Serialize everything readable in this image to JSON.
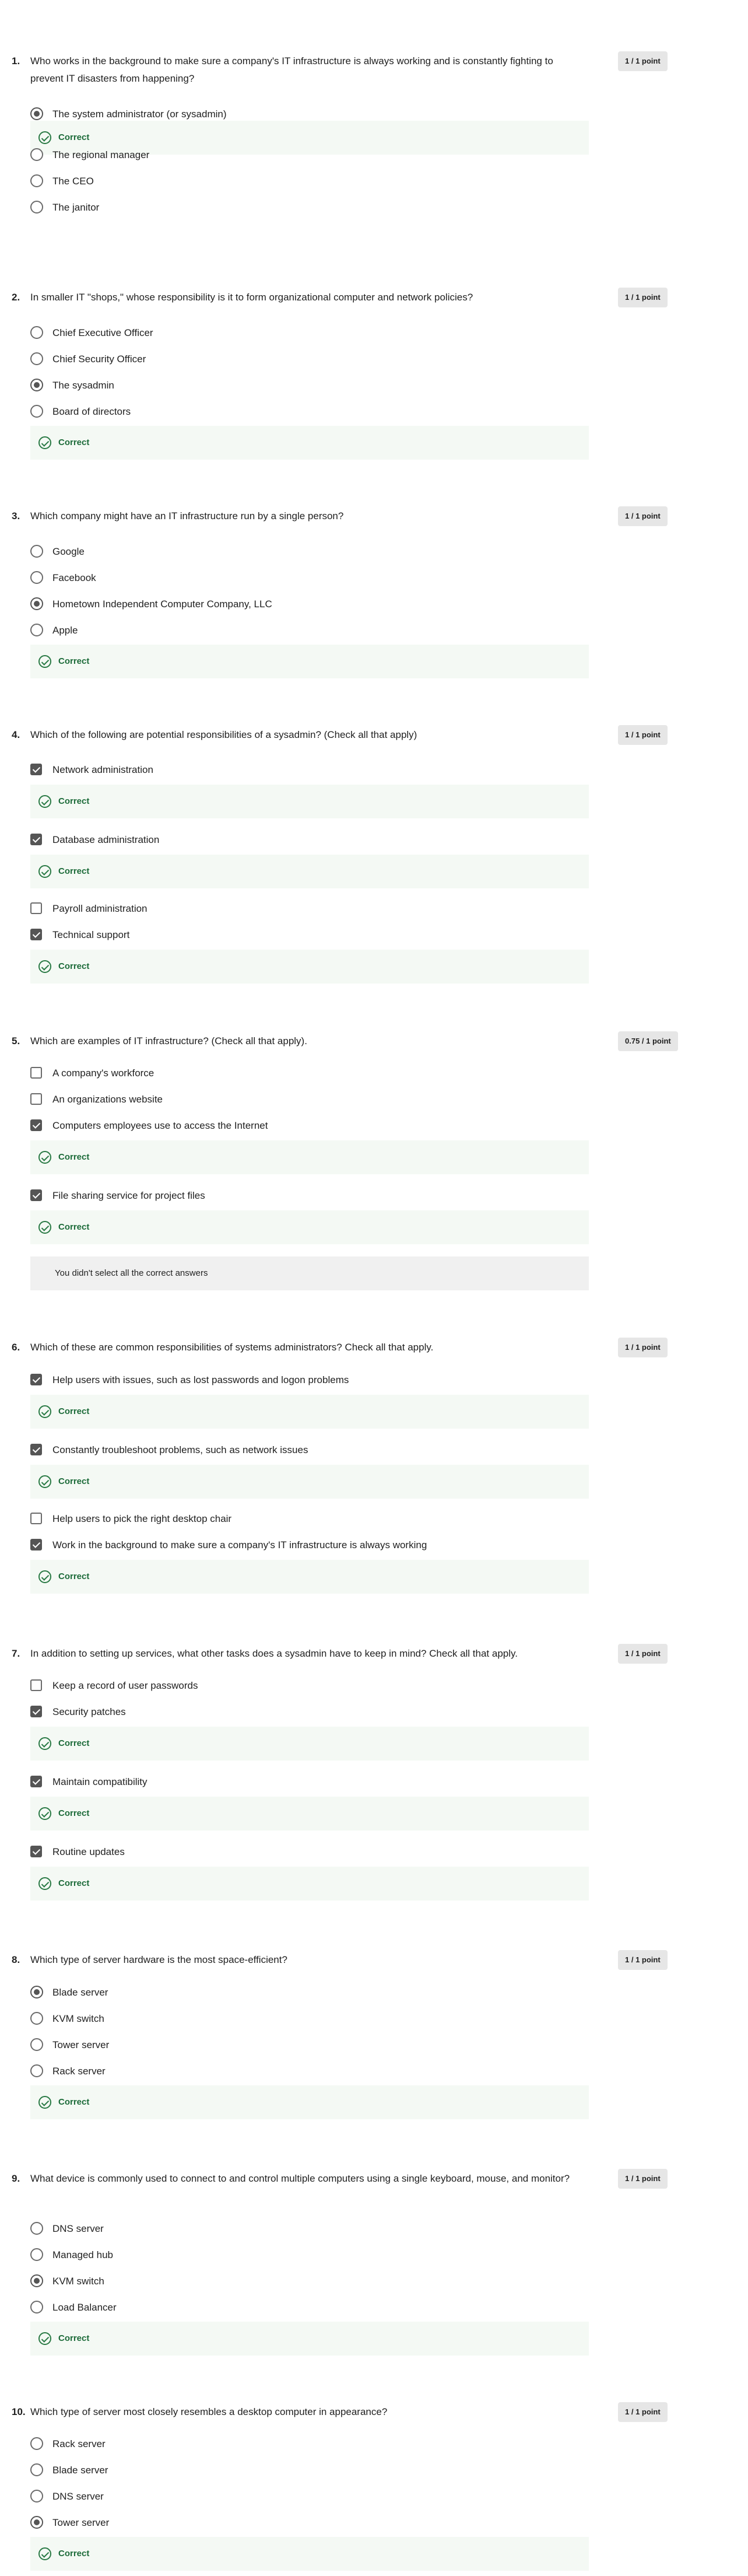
{
  "questions": [
    {
      "number": "1.",
      "text": "Who works in the background to make sure a company's IT infrastructure is always working and is constantly fighting to prevent IT disasters from happening?",
      "points": "1 / 1 point",
      "items": [
        {
          "kind": "radio",
          "label": "The system administrator (or sysadmin)",
          "selected": true
        },
        {
          "kind": "feedback",
          "label": "Correct"
        },
        {
          "kind": "radio",
          "label": "The regional manager",
          "selected": false
        },
        {
          "kind": "radio",
          "label": "The CEO",
          "selected": false
        },
        {
          "kind": "radio",
          "label": "The janitor",
          "selected": false
        }
      ]
    },
    {
      "number": "2.",
      "text": "In smaller IT \"shops,\" whose responsibility is it to form organizational computer and network policies?",
      "points": "1 / 1 point",
      "items": [
        {
          "kind": "radio",
          "label": "Chief Executive Officer",
          "selected": false
        },
        {
          "kind": "radio",
          "label": "Chief Security Officer",
          "selected": false
        },
        {
          "kind": "radio",
          "label": "The sysadmin",
          "selected": true
        },
        {
          "kind": "radio",
          "label": "Board of directors",
          "selected": false
        },
        {
          "kind": "feedback",
          "label": "Correct"
        }
      ]
    },
    {
      "number": "3.",
      "text": "Which company might have an IT infrastructure run by a single person?",
      "points": "1 / 1 point",
      "items": [
        {
          "kind": "radio",
          "label": "Google",
          "selected": false
        },
        {
          "kind": "radio",
          "label": "Facebook",
          "selected": false
        },
        {
          "kind": "radio",
          "label": "Hometown Independent Computer Company, LLC",
          "selected": true
        },
        {
          "kind": "radio",
          "label": "Apple",
          "selected": false
        },
        {
          "kind": "feedback",
          "label": "Correct"
        }
      ]
    },
    {
      "number": "4.",
      "text": "Which of the following are potential responsibilities of a sysadmin? (Check all that apply)",
      "points": "1 / 1 point",
      "items": [
        {
          "kind": "check",
          "label": "Network administration",
          "selected": true
        },
        {
          "kind": "feedback",
          "label": "Correct"
        },
        {
          "kind": "check",
          "label": "Database administration",
          "selected": true
        },
        {
          "kind": "feedback",
          "label": "Correct"
        },
        {
          "kind": "check",
          "label": "Payroll administration",
          "selected": false
        },
        {
          "kind": "check",
          "label": "Technical support",
          "selected": true
        },
        {
          "kind": "feedback",
          "label": "Correct"
        }
      ]
    },
    {
      "number": "5.",
      "text": "Which are examples of IT infrastructure? (Check all that apply).",
      "points": "0.75 / 1 point",
      "items": [
        {
          "kind": "check",
          "label": "A company's workforce",
          "selected": false
        },
        {
          "kind": "check",
          "label": "An organizations website",
          "selected": false
        },
        {
          "kind": "check",
          "label": "Computers employees use to access the Internet",
          "selected": true
        },
        {
          "kind": "feedback",
          "label": "Correct"
        },
        {
          "kind": "check",
          "label": "File sharing service for project files",
          "selected": true
        },
        {
          "kind": "feedback",
          "label": "Correct"
        },
        {
          "kind": "note",
          "label": "You didn't select all the correct answers"
        }
      ]
    },
    {
      "number": "6.",
      "text": "Which of these are common responsibilities of systems administrators? Check all that apply.",
      "points": "1 / 1 point",
      "items": [
        {
          "kind": "check",
          "label": "Help users with issues, such as lost passwords and logon problems",
          "selected": true
        },
        {
          "kind": "feedback",
          "label": "Correct"
        },
        {
          "kind": "check",
          "label": "Constantly troubleshoot problems, such as network issues",
          "selected": true
        },
        {
          "kind": "feedback",
          "label": "Correct"
        },
        {
          "kind": "check",
          "label": "Help users to pick the right desktop chair",
          "selected": false
        },
        {
          "kind": "check",
          "label": "Work in the background to make sure a company's IT infrastructure is always working",
          "selected": true
        },
        {
          "kind": "feedback",
          "label": "Correct"
        }
      ]
    },
    {
      "number": "7.",
      "text": "In addition to setting up services, what other tasks does a sysadmin have to keep in mind? Check all that apply.",
      "points": "1 / 1 point",
      "items": [
        {
          "kind": "check",
          "label": "Keep a record of user passwords",
          "selected": false
        },
        {
          "kind": "check",
          "label": "Security patches",
          "selected": true
        },
        {
          "kind": "feedback",
          "label": "Correct"
        },
        {
          "kind": "check",
          "label": "Maintain compatibility",
          "selected": true
        },
        {
          "kind": "feedback",
          "label": "Correct"
        },
        {
          "kind": "check",
          "label": "Routine updates",
          "selected": true
        },
        {
          "kind": "feedback",
          "label": "Correct"
        }
      ]
    },
    {
      "number": "8.",
      "text": "Which type of server hardware is the most space-efficient?",
      "points": "1 / 1 point",
      "items": [
        {
          "kind": "radio",
          "label": "Blade server",
          "selected": true
        },
        {
          "kind": "radio",
          "label": "KVM switch",
          "selected": false
        },
        {
          "kind": "radio",
          "label": "Tower server",
          "selected": false
        },
        {
          "kind": "radio",
          "label": "Rack server",
          "selected": false
        },
        {
          "kind": "feedback",
          "label": "Correct"
        }
      ]
    },
    {
      "number": "9.",
      "text": "What device is commonly used to connect to and control multiple computers using a single keyboard, mouse, and monitor?",
      "points": "1 / 1 point",
      "items": [
        {
          "kind": "radio",
          "label": "DNS server",
          "selected": false
        },
        {
          "kind": "radio",
          "label": "Managed hub",
          "selected": false
        },
        {
          "kind": "radio",
          "label": "KVM switch",
          "selected": true
        },
        {
          "kind": "radio",
          "label": "Load Balancer",
          "selected": false
        },
        {
          "kind": "feedback",
          "label": "Correct"
        }
      ]
    },
    {
      "number": "10.",
      "text": "Which type of server most closely resembles a desktop computer in appearance?",
      "points": "1 / 1 point",
      "items": [
        {
          "kind": "radio",
          "label": "Rack server",
          "selected": false
        },
        {
          "kind": "radio",
          "label": "Blade server",
          "selected": false
        },
        {
          "kind": "radio",
          "label": "DNS server",
          "selected": false
        },
        {
          "kind": "radio",
          "label": "Tower server",
          "selected": true
        },
        {
          "kind": "feedback",
          "label": "Correct"
        }
      ]
    }
  ]
}
